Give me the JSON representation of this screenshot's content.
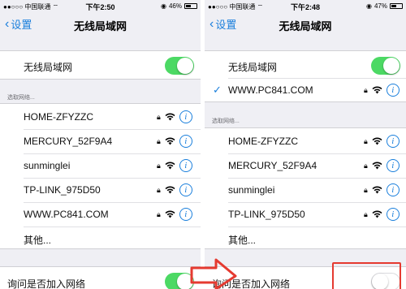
{
  "left": {
    "status": {
      "carrier": "中国联通",
      "time": "下午2:50",
      "battery": "46%",
      "battery_level": 0.46
    },
    "nav": {
      "back_label": "设置",
      "title": "无线局域网"
    },
    "wifi_toggle_label": "无线局域网",
    "section_header": "选取网络...",
    "networks": [
      "HOME-ZFYZZC",
      "MERCURY_52F9A4",
      "sunminglei",
      "TP-LINK_975D50",
      "WWW.PC841.COM"
    ],
    "other_label": "其他...",
    "ask_label": "询问是否加入网络"
  },
  "right": {
    "status": {
      "carrier": "中国联通",
      "time": "下午2:48",
      "battery": "47%",
      "battery_level": 0.47
    },
    "nav": {
      "back_label": "设置",
      "title": "无线局域网"
    },
    "wifi_toggle_label": "无线局域网",
    "connected_network": "WWW.PC841.COM",
    "section_header": "选取网络...",
    "networks": [
      "HOME-ZFYZZC",
      "MERCURY_52F9A4",
      "sunminglei",
      "TP-LINK_975D50"
    ],
    "other_label": "其他...",
    "ask_label": "询问是否加入网络"
  },
  "colors": {
    "accent": "#1a7fdc",
    "toggle_on": "#4cd964",
    "annotation": "#e53a30"
  }
}
